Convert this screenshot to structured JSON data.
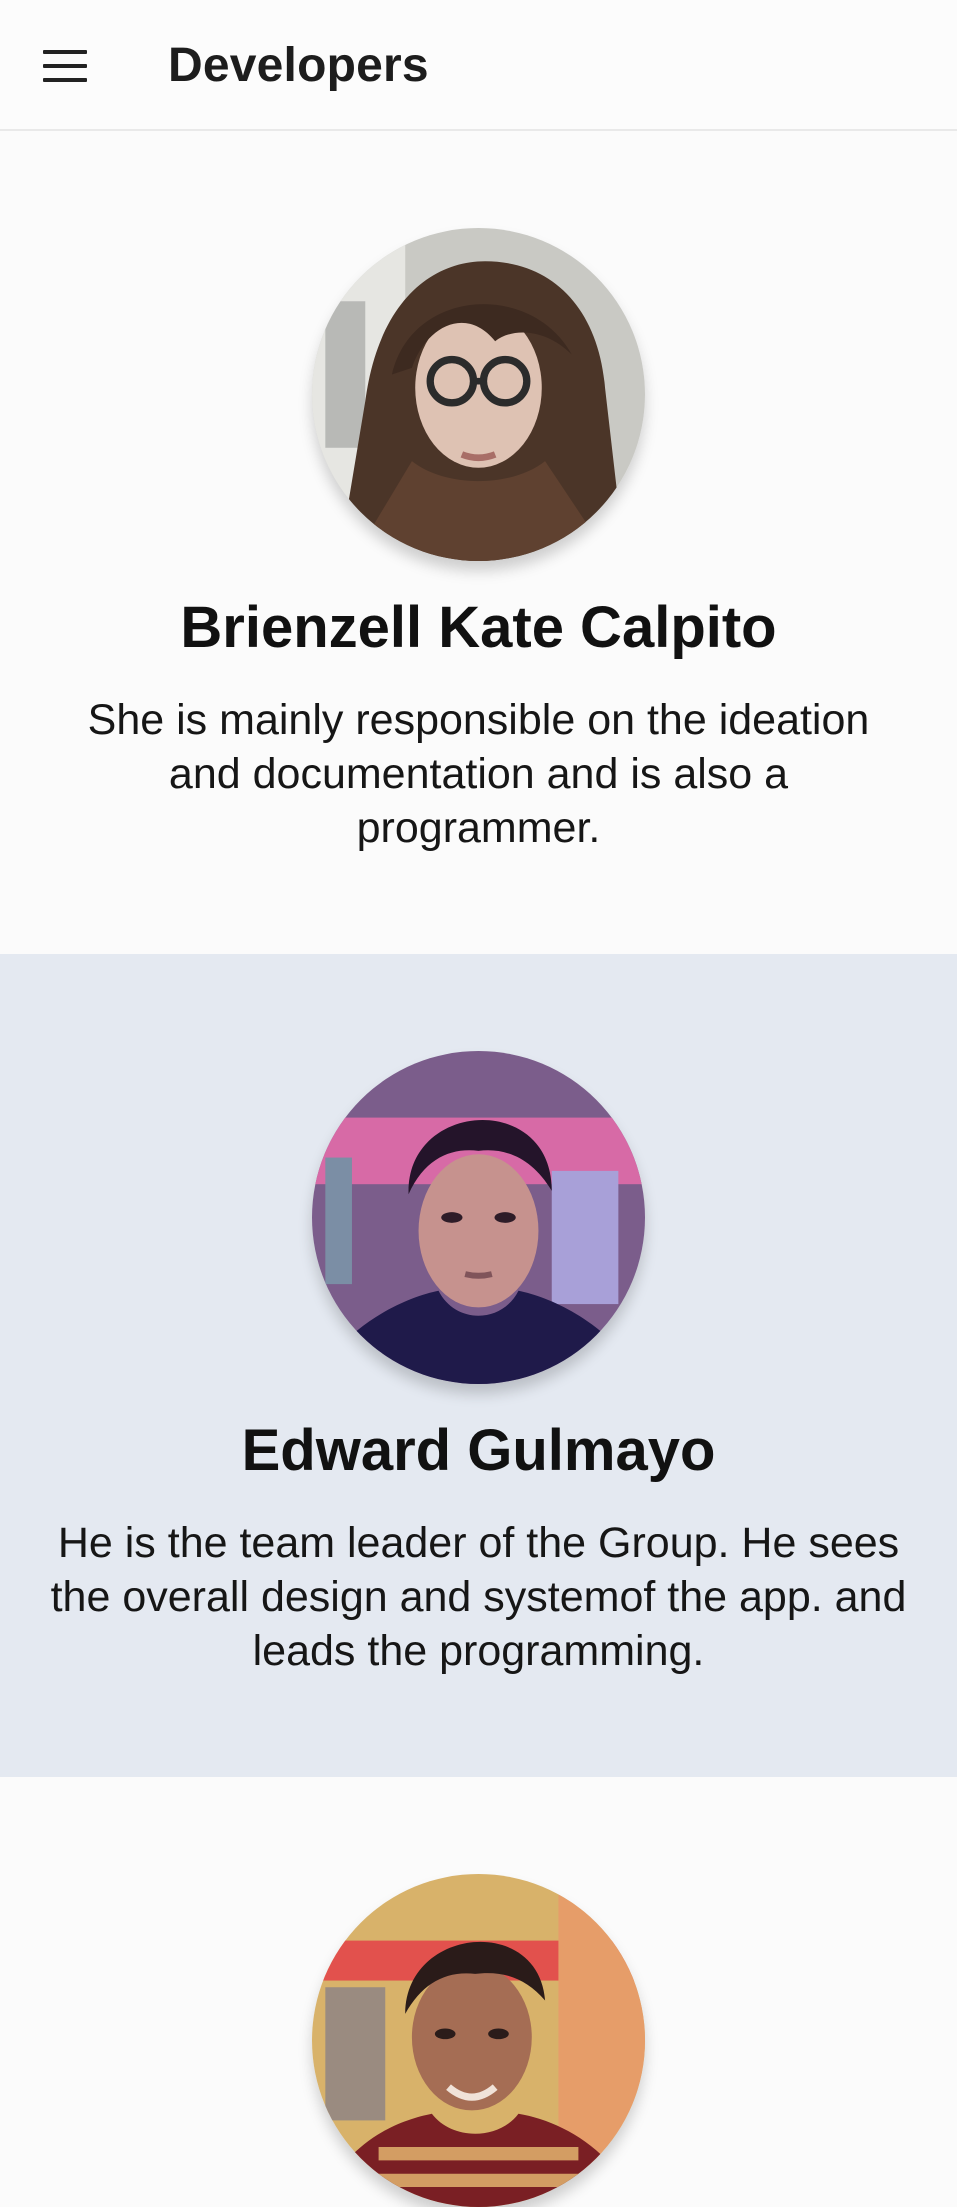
{
  "header": {
    "title": "Developers",
    "menu_icon": "hamburger-menu-icon"
  },
  "developers": [
    {
      "name": "Brienzell Kate Calpito",
      "description": "She is mainly responsible on the ideation and documentation and is also a programmer.",
      "avatar": "profile-photo"
    },
    {
      "name": "Edward Gulmayo",
      "description": "He is the team leader of the Group. He sees the overall design and systemof the app. and leads the programming.",
      "avatar": "profile-photo"
    },
    {
      "avatar": "profile-photo"
    }
  ],
  "colors": {
    "page_background": "#fbfbfb",
    "alternate_card_background": "#e4e9f1",
    "text": "#151515"
  }
}
